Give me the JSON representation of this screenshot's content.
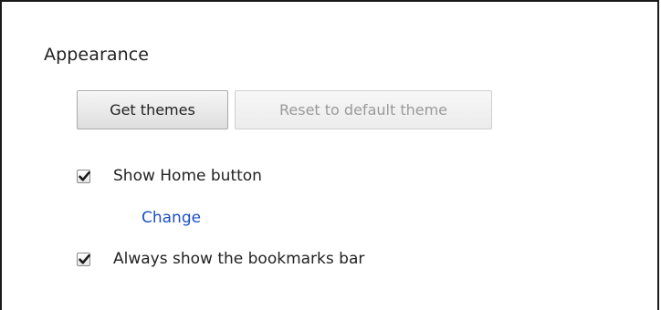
{
  "section": {
    "title": "Appearance"
  },
  "buttons": {
    "get_themes": "Get themes",
    "reset_theme": "Reset to default theme"
  },
  "options": {
    "show_home": {
      "label": "Show Home button",
      "checked": true,
      "change_link": "Change"
    },
    "bookmarks_bar": {
      "label": "Always show the bookmarks bar",
      "checked": true
    }
  }
}
